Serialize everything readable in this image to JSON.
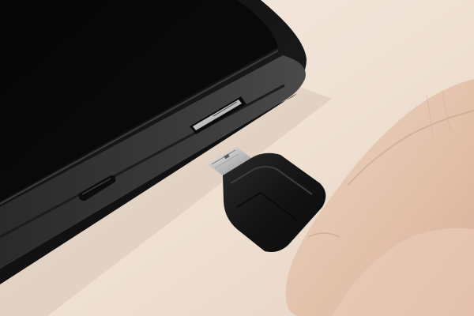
{
  "photo": {
    "subject": "",
    "colors": {
      "background": "#efe2d4",
      "device_body": "#1b1b1b",
      "device_edge": "#2e2e2e",
      "connector_metal": "#d9d9d9",
      "plug_housing": "#151515",
      "skin": "#e6c9b3"
    }
  }
}
